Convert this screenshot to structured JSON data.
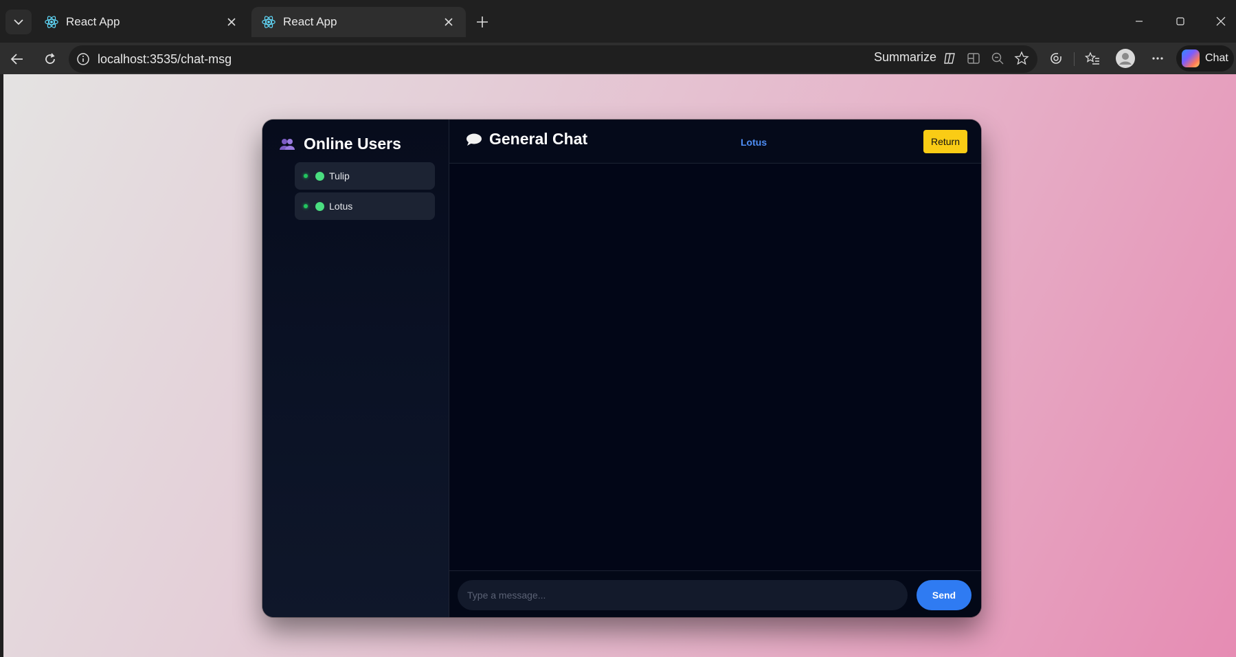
{
  "browser": {
    "tabs": [
      {
        "title": "React App",
        "active": false
      },
      {
        "title": "React App",
        "active": true
      }
    ],
    "url": "localhost:3535/chat-msg",
    "summarize_label": "Summarize",
    "chat_label": "Chat",
    "icons": [
      "tab-menu-icon",
      "react-icon",
      "close-icon",
      "new-tab-icon",
      "minimize-icon",
      "restore-icon",
      "window-close-icon",
      "back-icon",
      "refresh-icon",
      "info-icon",
      "copilot-icon",
      "split-screen-icon",
      "zoom-out-icon",
      "favorite-star-icon",
      "extensions-icon",
      "favorites-list-icon",
      "profile-icon",
      "more-icon"
    ]
  },
  "sidebar": {
    "title": "Online Users",
    "users": [
      {
        "name": "Tulip",
        "status_color": "#22c55e"
      },
      {
        "name": "Lotus",
        "status_color": "#22c55e"
      }
    ]
  },
  "chat": {
    "title": "General Chat",
    "current_user": "Lotus",
    "return_label": "Return",
    "input_placeholder": "Type a message...",
    "input_value": "",
    "send_label": "Send",
    "messages": []
  },
  "colors": {
    "accent_blue": "#2f7bf2",
    "return_yellow": "#facc15",
    "online_green": "#22c55e"
  }
}
